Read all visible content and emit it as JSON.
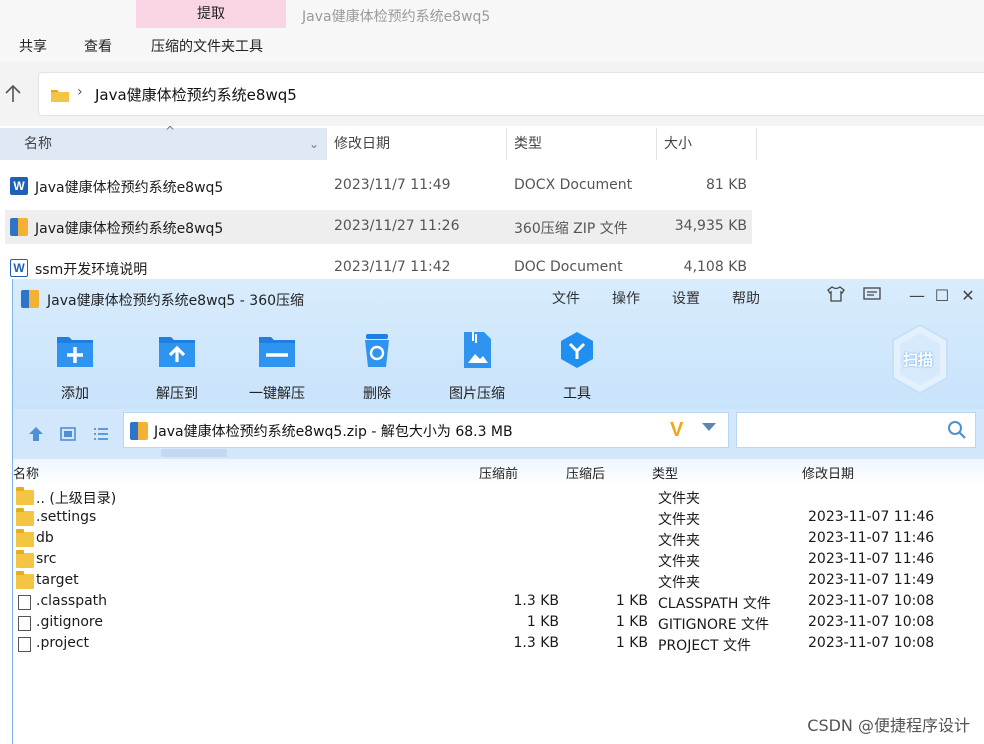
{
  "explorer": {
    "ribbon_tab_active": "提取",
    "window_title": "Java健康体检预约系统e8wq5",
    "menu": [
      "共享",
      "查看",
      "压缩的文件夹工具"
    ],
    "address_path": "Java健康体检预约系统e8wq5",
    "columns": {
      "name": "名称",
      "date": "修改日期",
      "type": "类型",
      "size": "大小"
    },
    "files": [
      {
        "name": "Java健康体检预约系统e8wq5",
        "date": "2023/11/7 11:49",
        "type": "DOCX Document",
        "size": "81 KB",
        "icon": "word-docx-icon",
        "selected": false
      },
      {
        "name": "Java健康体检预约系统e8wq5",
        "date": "2023/11/27 11:26",
        "type": "360压缩 ZIP 文件",
        "size": "34,935 KB",
        "icon": "zip-archive-icon",
        "selected": true
      },
      {
        "name": "ssm开发环境说明",
        "date": "2023/11/7 11:42",
        "type": "DOC Document",
        "size": "4,108 KB",
        "icon": "word-doc-icon",
        "selected": false
      }
    ]
  },
  "zip": {
    "title": "Java健康体检预约系统e8wq5 - 360压缩",
    "menu": {
      "file": "文件",
      "ops": "操作",
      "settings": "设置",
      "help": "帮助"
    },
    "toolbar": {
      "add": "添加",
      "extract_to": "解压到",
      "one_click": "一键解压",
      "delete": "删除",
      "image_compress": "图片压缩",
      "tools": "工具"
    },
    "scan_label": "扫描",
    "address": "Java健康体检预约系统e8wq5.zip - 解包大小为 68.3 MB",
    "search_placeholder": "",
    "columns": {
      "name": "名称",
      "before": "压缩前",
      "after": "压缩后",
      "type": "类型",
      "date": "修改日期"
    },
    "entries": [
      {
        "name": ".. (上级目录)",
        "before": "",
        "after": "",
        "type": "文件夹",
        "date": "",
        "kind": "folder"
      },
      {
        "name": ".settings",
        "before": "",
        "after": "",
        "type": "文件夹",
        "date": "2023-11-07 11:46",
        "kind": "folder"
      },
      {
        "name": "db",
        "before": "",
        "after": "",
        "type": "文件夹",
        "date": "2023-11-07 11:46",
        "kind": "folder"
      },
      {
        "name": "src",
        "before": "",
        "after": "",
        "type": "文件夹",
        "date": "2023-11-07 11:46",
        "kind": "folder"
      },
      {
        "name": "target",
        "before": "",
        "after": "",
        "type": "文件夹",
        "date": "2023-11-07 11:49",
        "kind": "folder"
      },
      {
        "name": ".classpath",
        "before": "1.3 KB",
        "after": "1 KB",
        "type": "CLASSPATH 文件",
        "date": "2023-11-07 10:08",
        "kind": "file"
      },
      {
        "name": ".gitignore",
        "before": "1 KB",
        "after": "1 KB",
        "type": "GITIGNORE 文件",
        "date": "2023-11-07 10:08",
        "kind": "file"
      },
      {
        "name": ".project",
        "before": "1.3 KB",
        "after": "1 KB",
        "type": "PROJECT 文件",
        "date": "2023-11-07 10:08",
        "kind": "file"
      }
    ]
  },
  "watermark": "CSDN @便捷程序设计"
}
